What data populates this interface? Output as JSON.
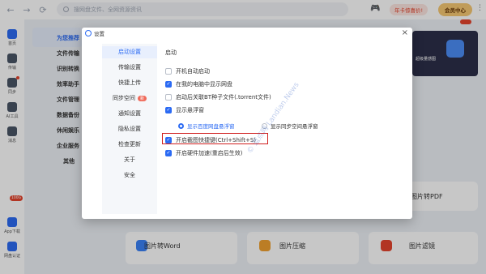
{
  "topbar": {
    "back": "←",
    "forward": "→",
    "refresh": "⟳",
    "search_placeholder": "搜网盘文件、全网资源资讯",
    "promo": "年卡惊喜价!",
    "member": "会员中心",
    "more": "⋮"
  },
  "rail": {
    "items": [
      {
        "label": "首页"
      },
      {
        "label": "传输"
      },
      {
        "label": "同步"
      },
      {
        "label": "AI工具"
      },
      {
        "label": "消息"
      }
    ],
    "app_download": "App下载",
    "app_badge": "100G",
    "net_auth": "网盘认证"
  },
  "subnav": {
    "items": [
      {
        "label": "为您推荐"
      },
      {
        "label": "文件传输"
      },
      {
        "label": "识别转换"
      },
      {
        "label": "效率助手"
      },
      {
        "label": "文件管理"
      },
      {
        "label": "数据备份"
      },
      {
        "label": "休闲娱乐"
      },
      {
        "label": "企业服务"
      },
      {
        "label": "其他"
      }
    ]
  },
  "background_tools": {
    "banner_text": "超级量感图",
    "tool_pdf": "图片转PDF",
    "tool_word": "图片转Word",
    "tool_compress": "图片压缩",
    "tool_filter": "图片滤镜"
  },
  "dialog": {
    "title": "设置",
    "close": "×",
    "sidebar": [
      {
        "label": "启动设置"
      },
      {
        "label": "传输设置"
      },
      {
        "label": "快捷上传"
      },
      {
        "label": "同步空间",
        "tag": "新"
      },
      {
        "label": "通知设置"
      },
      {
        "label": "隐私设置"
      },
      {
        "label": "检查更新"
      },
      {
        "label": "关于"
      },
      {
        "label": "安全"
      }
    ],
    "section_title": "启动",
    "options": [
      {
        "label": "开机自动启动",
        "checked": false
      },
      {
        "label": "在我的电脑中显示网盘",
        "checked": true
      },
      {
        "label": "启动后关联BT种子文件(.torrent文件)",
        "checked": false
      },
      {
        "label": "显示悬浮窗",
        "checked": true
      },
      {
        "label": "开启截图快捷键(Ctrl+Shift+S)",
        "checked": true
      },
      {
        "label": "开启硬件加速(重启后生效)",
        "checked": true
      }
    ],
    "radios": [
      {
        "label": "显示百度网盘悬浮窗",
        "selected": true
      },
      {
        "label": "显示同步空间悬浮窗",
        "selected": false
      }
    ]
  },
  "watermark": "© 蓝点网 Landian.News",
  "colors": {
    "accent": "#2c6bf3",
    "highlight": "#d01f1f",
    "member": "#f6c873"
  }
}
